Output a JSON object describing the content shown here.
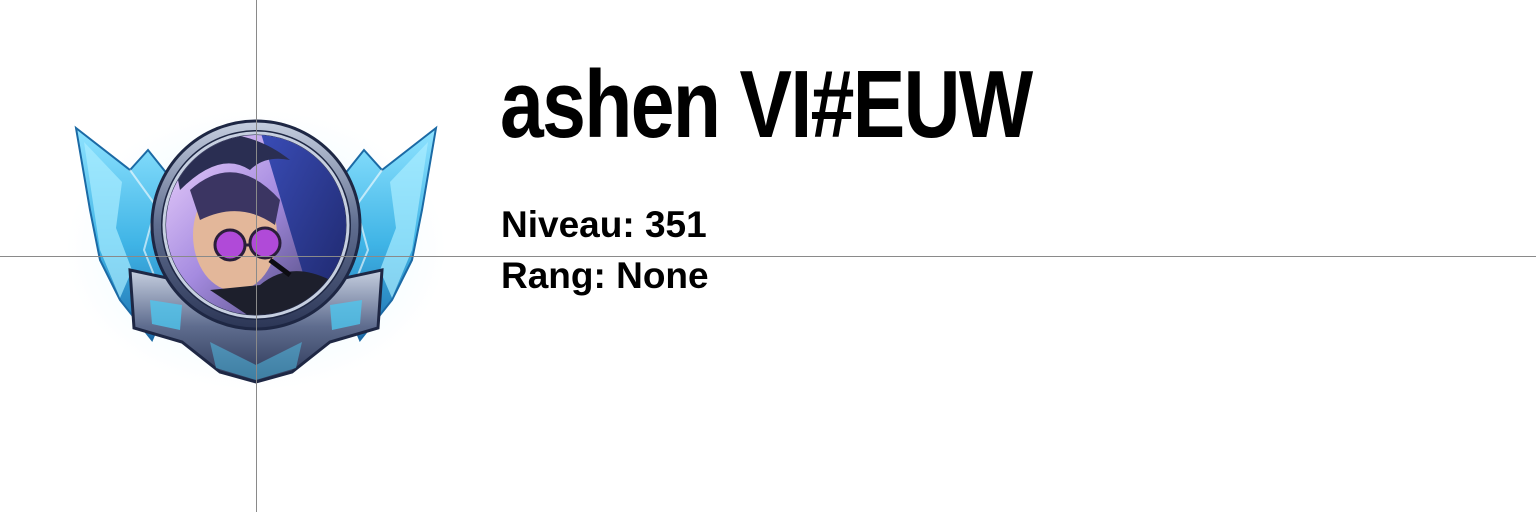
{
  "profile": {
    "summoner_name": "ashen VI#EUW",
    "level_label": "Niveau:",
    "level_value": "351",
    "rank_label": "Rang:",
    "rank_value": "None"
  },
  "emblem": {
    "icon": "champion-portrait-icon",
    "frame": "crystal-wing-border",
    "colors": {
      "crystal": "#4fc6ee",
      "crystal_dark": "#1f6fae",
      "frame": "#3b4a6e",
      "frame_light": "#9aa7c2",
      "hair": "#2c3a8a",
      "glasses": "#b04ad8"
    }
  },
  "colors": {
    "background": "#ffffff",
    "text": "#000000",
    "guide": "#8a8a8a"
  }
}
